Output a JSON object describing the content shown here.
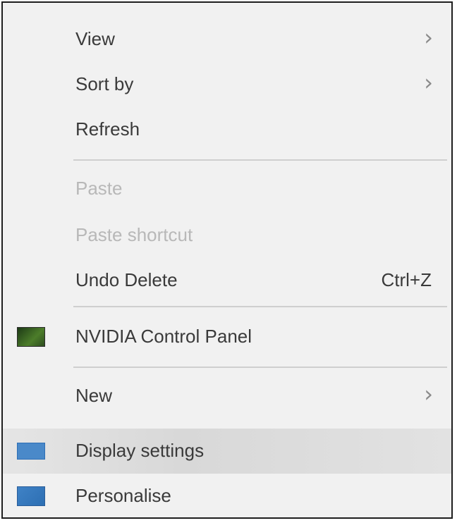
{
  "menu": {
    "items": [
      {
        "label": "View",
        "arrow": "›"
      },
      {
        "label": "Sort by",
        "arrow": "›"
      },
      {
        "label": "Refresh"
      },
      {
        "label": "Paste",
        "disabled": true
      },
      {
        "label": "Paste shortcut",
        "disabled": true
      },
      {
        "label": "Undo Delete",
        "shortcut": "Ctrl+Z"
      },
      {
        "label": "NVIDIA Control Panel",
        "icon": "nvidia-icon"
      },
      {
        "label": "New",
        "arrow": "›"
      },
      {
        "label": "Display settings",
        "icon": "display-icon",
        "highlighted": true
      },
      {
        "label": "Personalise",
        "icon": "personalise-icon"
      }
    ]
  },
  "colors": {
    "menu_background": "#f1f1f1",
    "text": "#3a3a3a",
    "disabled_text": "#b8b8b8",
    "separator": "#cfcfcf",
    "border": "#1e1e1e"
  }
}
